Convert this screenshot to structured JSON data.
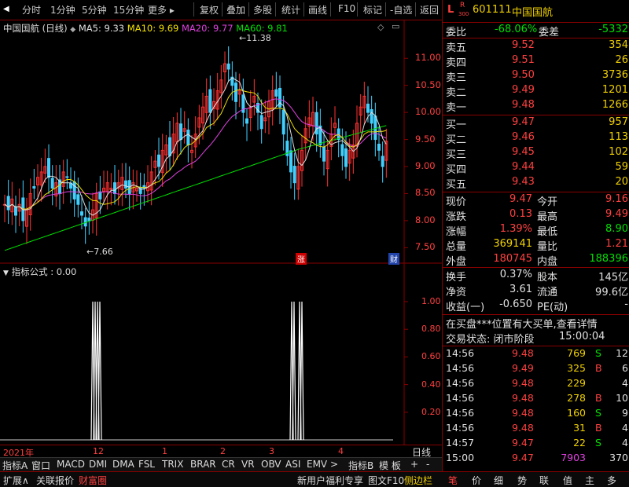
{
  "toolbar": {
    "left": [
      "分时",
      "1分钟",
      "5分钟",
      "15分钟",
      "更多 ▸"
    ],
    "right": [
      "复权",
      "叠加",
      "多股",
      "统计",
      "画线",
      "F10",
      "标记",
      "-自选",
      "返回"
    ]
  },
  "chart": {
    "title": "中国国航 (日线)",
    "ma5": "MA5: 9.33",
    "ma10": "MA10: 9.69",
    "ma20": "MA20: 9.77",
    "ma60": "MA60: 9.81",
    "high_mark": "11.38",
    "low_mark": "7.66",
    "badge_zhang": "涨",
    "badge_cai": "财",
    "price_ticks": [
      "11.00",
      "10.50",
      "10.00",
      "9.50",
      "9.00",
      "8.50",
      "8.00",
      "7.50"
    ],
    "indicator_title": "指标公式 : 0.00",
    "indicator_ticks": [
      "1.00",
      "0.80",
      "0.60",
      "0.40",
      "0.20"
    ],
    "time_labels": [
      "2021年",
      "12",
      "1",
      "2",
      "3",
      "4"
    ],
    "period": "日线",
    "colors": {
      "ma5": "#e0e0e0",
      "ma10": "#f0e000",
      "ma20": "#e040e0",
      "ma60": "#00e000",
      "up": "#ff3030",
      "down": "#40d0ff"
    }
  },
  "tabs": [
    "指标A",
    "窗口",
    "MACD",
    "DMI",
    "DMA",
    "FSL",
    "TRIX",
    "BRAR",
    "CR",
    "VR",
    "OBV",
    "ASI",
    "EMV",
    ">",
    "指标B",
    "模 板",
    "+",
    "-"
  ],
  "bottom_bar": {
    "left": [
      "扩展∧",
      "关联报价",
      "财富圈"
    ],
    "right": [
      "新用户福利专享",
      "图文F10",
      "侧边栏"
    ],
    "quote_tabs": [
      "笔",
      "价",
      "细",
      "势",
      "联",
      "值",
      "主",
      "多"
    ]
  },
  "quote": {
    "flag": "L",
    "tag_r": "R",
    "tag_300": "300",
    "code": "601111",
    "name": "中国国航",
    "weibi_label": "委比",
    "weibi": "-68.06%",
    "weicha_label": "委差",
    "weicha": "-5332",
    "sells": [
      {
        "label": "卖五",
        "price": "9.52",
        "vol": "354"
      },
      {
        "label": "卖四",
        "price": "9.51",
        "vol": "26"
      },
      {
        "label": "卖三",
        "price": "9.50",
        "vol": "3736"
      },
      {
        "label": "卖二",
        "price": "9.49",
        "vol": "1201"
      },
      {
        "label": "卖一",
        "price": "9.48",
        "vol": "1266"
      }
    ],
    "buys": [
      {
        "label": "买一",
        "price": "9.47",
        "vol": "957"
      },
      {
        "label": "买二",
        "price": "9.46",
        "vol": "113"
      },
      {
        "label": "买三",
        "price": "9.45",
        "vol": "102"
      },
      {
        "label": "买四",
        "price": "9.44",
        "vol": "59"
      },
      {
        "label": "买五",
        "price": "9.43",
        "vol": "20"
      }
    ],
    "stats": [
      {
        "l1": "现价",
        "v1": "9.47",
        "l2": "今开",
        "v2": "9.16"
      },
      {
        "l1": "涨跌",
        "v1": "0.13",
        "l2": "最高",
        "v2": "9.49"
      },
      {
        "l1": "涨幅",
        "v1": "1.39%",
        "l2": "最低",
        "v2": "8.90"
      },
      {
        "l1": "总量",
        "v1": "369141",
        "l2": "量比",
        "v2": "1.21"
      },
      {
        "l1": "外盘",
        "v1": "180745",
        "l2": "内盘",
        "v2": "188396"
      }
    ],
    "stats2": [
      {
        "l1": "换手",
        "v1": "0.37%",
        "l2": "股本",
        "v2": "145亿"
      },
      {
        "l1": "净资",
        "v1": "3.61",
        "l2": "流通",
        "v2": "99.6亿"
      },
      {
        "l1": "收益(一)",
        "v1": "-0.650",
        "l2": "PE(动)",
        "v2": "-"
      }
    ],
    "notice": "在买盘***位置有大买单,查看详情",
    "status_label": "交易状态: 闭市阶段",
    "status_time": "15:00:04",
    "ticks": [
      {
        "t": "14:56",
        "p": "9.48",
        "v": "769",
        "s": "S",
        "n": "12"
      },
      {
        "t": "14:56",
        "p": "9.49",
        "v": "325",
        "s": "B",
        "n": "6"
      },
      {
        "t": "14:56",
        "p": "9.48",
        "v": "229",
        "s": "",
        "n": "4"
      },
      {
        "t": "14:56",
        "p": "9.48",
        "v": "278",
        "s": "B",
        "n": "10"
      },
      {
        "t": "14:56",
        "p": "9.48",
        "v": "160",
        "s": "S",
        "n": "9"
      },
      {
        "t": "14:56",
        "p": "9.48",
        "v": "31",
        "s": "B",
        "n": "4"
      },
      {
        "t": "14:57",
        "p": "9.47",
        "v": "22",
        "s": "S",
        "n": "4"
      },
      {
        "t": "15:00",
        "p": "9.47",
        "v": "7903",
        "s": "",
        "n": "370"
      }
    ]
  }
}
